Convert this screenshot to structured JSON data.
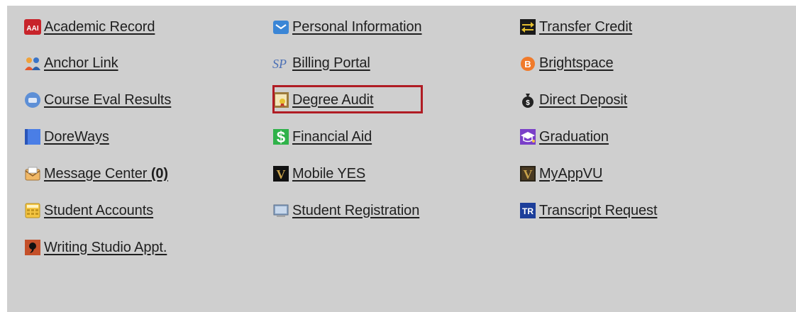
{
  "links": {
    "col0": [
      {
        "label": "Academic Record",
        "icon": "aai-icon"
      },
      {
        "label": "Anchor Link",
        "icon": "people-icon"
      },
      {
        "label": "Course Eval Results",
        "icon": "chat-bubble-icon"
      },
      {
        "label": "DoreWays",
        "icon": "blue-square-icon"
      },
      {
        "label": "Message Center",
        "count": "(0)",
        "icon": "envelope-open-icon"
      },
      {
        "label": "Student Accounts",
        "icon": "calculator-icon"
      },
      {
        "label": "Writing Studio Appt.",
        "icon": "speech-comma-icon"
      }
    ],
    "col1": [
      {
        "label": "Personal Information",
        "icon": "mail-icon"
      },
      {
        "label": "Billing Portal",
        "icon": "sp-icon",
        "icon_text": "SP"
      },
      {
        "label": "Degree Audit",
        "icon": "diploma-icon"
      },
      {
        "label": "Financial Aid",
        "icon": "dollar-icon",
        "icon_text": "$"
      },
      {
        "label": "Mobile YES",
        "icon": "vanderbilt-v-icon",
        "icon_text": "V"
      },
      {
        "label": "Student Registration",
        "icon": "monitor-icon"
      }
    ],
    "col2": [
      {
        "label": "Transfer Credit",
        "icon": "arrows-exchange-icon"
      },
      {
        "label": "Brightspace",
        "icon": "brightspace-icon",
        "icon_text": "B"
      },
      {
        "label": "Direct Deposit",
        "icon": "money-bag-icon",
        "icon_text": "$"
      },
      {
        "label": "Graduation",
        "icon": "graduation-cap-icon"
      },
      {
        "label": "MyAppVU",
        "icon": "vanderbilt-v-icon",
        "icon_text": "V"
      },
      {
        "label": "Transcript Request",
        "icon": "tr-icon",
        "icon_text": "TR"
      }
    ]
  },
  "icon_aai_text": "AAI",
  "colors": {
    "panel_bg": "#cfcfcf",
    "link_text": "#1f1f1f",
    "highlight_border": "#b01c24"
  },
  "highlighted_item": "Degree Audit"
}
